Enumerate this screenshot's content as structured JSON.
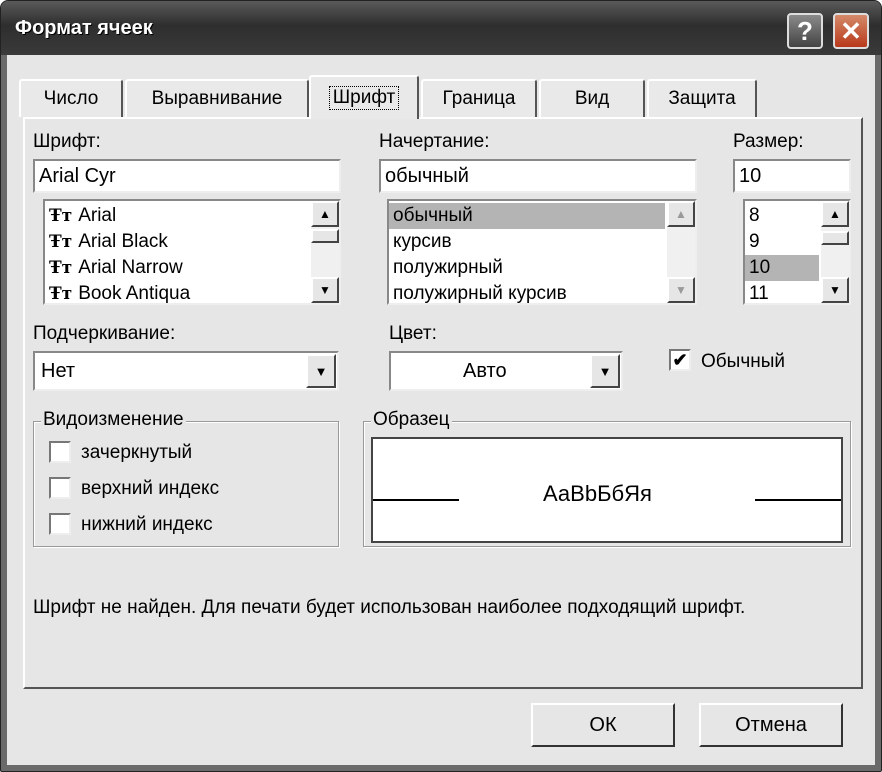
{
  "window": {
    "title": "Формат ячеек",
    "help_glyph": "?",
    "close_glyph": "✕"
  },
  "tabs": [
    {
      "label": "Число",
      "active": false
    },
    {
      "label": "Выравнивание",
      "active": false
    },
    {
      "label": "Шрифт",
      "active": true
    },
    {
      "label": "Граница",
      "active": false
    },
    {
      "label": "Вид",
      "active": false
    },
    {
      "label": "Защита",
      "active": false
    }
  ],
  "font": {
    "label": "Шрифт:",
    "value": "Arial Cyr",
    "items": [
      "Arial",
      "Arial Black",
      "Arial Narrow",
      "Book Antiqua"
    ],
    "item_icon": "truetype-font-icon",
    "item_glyph": "Ŧт"
  },
  "style": {
    "label": "Начертание:",
    "value": "обычный",
    "items": [
      "обычный",
      "курсив",
      "полужирный",
      "полужирный курсив"
    ],
    "selected": "обычный"
  },
  "size": {
    "label": "Размер:",
    "value": "10",
    "items": [
      "8",
      "9",
      "10",
      "11"
    ],
    "selected": "10"
  },
  "underline": {
    "label": "Подчеркивание:",
    "value": "Нет"
  },
  "color": {
    "label": "Цвет:",
    "value": "Авто"
  },
  "normal_font": {
    "label": "Обычный",
    "checked": true,
    "check_glyph": "✔"
  },
  "effects": {
    "title": "Видоизменение",
    "items": [
      {
        "label": "зачеркнутый",
        "checked": false
      },
      {
        "label": "верхний индекс",
        "checked": false
      },
      {
        "label": "нижний индекс",
        "checked": false
      }
    ]
  },
  "sample": {
    "title": "Образец",
    "text": "АаВbБбЯя"
  },
  "message": "Шрифт не найден. Для печати будет использован наиболее подходящий шрифт.",
  "buttons": {
    "ok": "ОК",
    "cancel": "Отмена"
  },
  "glyphs": {
    "up": "▲",
    "down": "▼"
  }
}
